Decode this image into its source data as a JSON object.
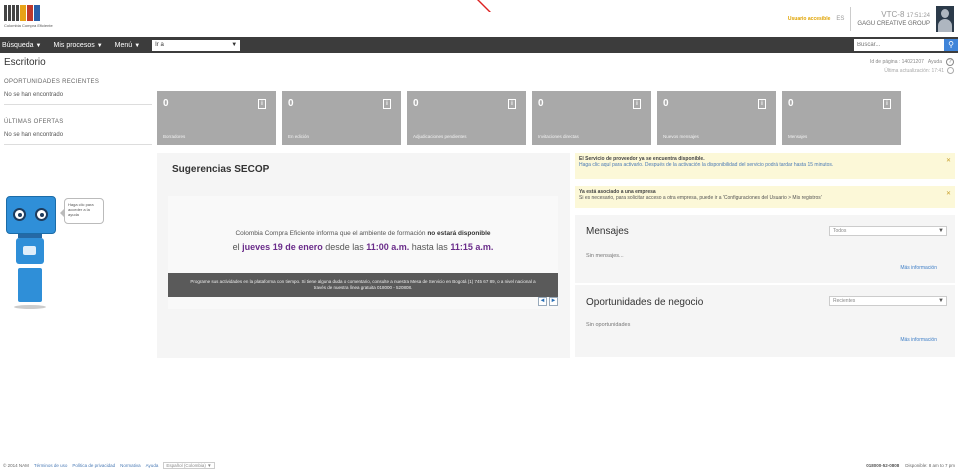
{
  "header": {
    "logo_text": "Colombia Compra Eficiente",
    "user_link": "Usuario accesible",
    "lang": "ES",
    "user_code": "VTC-8",
    "user_time": "17:51:24",
    "company": "GAGU CREATIVE GROUP"
  },
  "nav": {
    "items": [
      "Búsqueda",
      "Mis procesos",
      "Menú"
    ],
    "select_value": "Ir a",
    "search_placeholder": "Buscar..."
  },
  "page": {
    "title": "Escritorio",
    "page_id_label": "Id de página : 14021207",
    "help_label": "Ayuda",
    "last_update": "Última actualización: 17:41"
  },
  "sidebar": {
    "heading1": "OPORTUNIDADES RECIENTES",
    "empty1": "No se han encontrado",
    "heading2": "ÚLTIMAS OFERTAS",
    "empty2": "No se han encontrado",
    "bubble": "Haga clic para acceder a la ayuda"
  },
  "tiles": [
    {
      "value": "0",
      "label": "Borradores"
    },
    {
      "value": "0",
      "label": "En edición"
    },
    {
      "value": "0",
      "label": "Adjudicaciones pendientes"
    },
    {
      "value": "0",
      "label": "Invitaciones directas"
    },
    {
      "value": "0",
      "label": "Nuevos mensajes"
    },
    {
      "value": "0",
      "label": "Mensajes"
    }
  ],
  "sugerencias": {
    "title": "Sugerencias SECOP",
    "line1_pre": "Colombia Compra Eficiente informa que el ambiente de formación ",
    "line1_bold": "no estará disponible",
    "line2_pre": "el ",
    "line2_date": "jueves 19 de enero",
    "line2_mid": " desde las ",
    "line2_t1": "11:00 a.m.",
    "line2_mid2": " hasta las ",
    "line2_t2": "11:15 a.m.",
    "dark_text": "Programe sus actividades en la plataforma con tiempo. Si tiene alguna duda o comentario, consulte a nuestra Mesa de Servicio en Bogotá (1) 745 67 89, o a nivel nacional a través de nuestra línea gratuita 018000 - 520808."
  },
  "alerts": [
    {
      "title": "El Servicio de proveedor ya se encuentra disponible.",
      "text": "Haga clic aquí para activarlo. Después de la activación la disponibilidad del servicio podrá tardar hasta 15 minutos."
    },
    {
      "title": "Ya está asociado a una empresa",
      "text": "Si es necesario, para solicitar acceso a otra empresa, puede ir a 'Configuraciones del Usuario > Mis registros'"
    }
  ],
  "mensajes": {
    "title": "Mensajes",
    "filter": "Todos",
    "empty": "Sin mensajes...",
    "more": "Más información"
  },
  "oportunidades": {
    "title": "Oportunidades de negocio",
    "filter": "Recientes",
    "empty": "Sin oportunidades",
    "more": "Más información"
  },
  "footer": {
    "copyright": "© 2014 NAM",
    "links": [
      "Términos de uso",
      "Política de privacidad",
      "Normativa",
      "Ayuda"
    ],
    "lang_select": "Español (Colombia)",
    "phone": "018000-52-0808",
    "hours": "Disponible: 8 am to 7 pm"
  }
}
